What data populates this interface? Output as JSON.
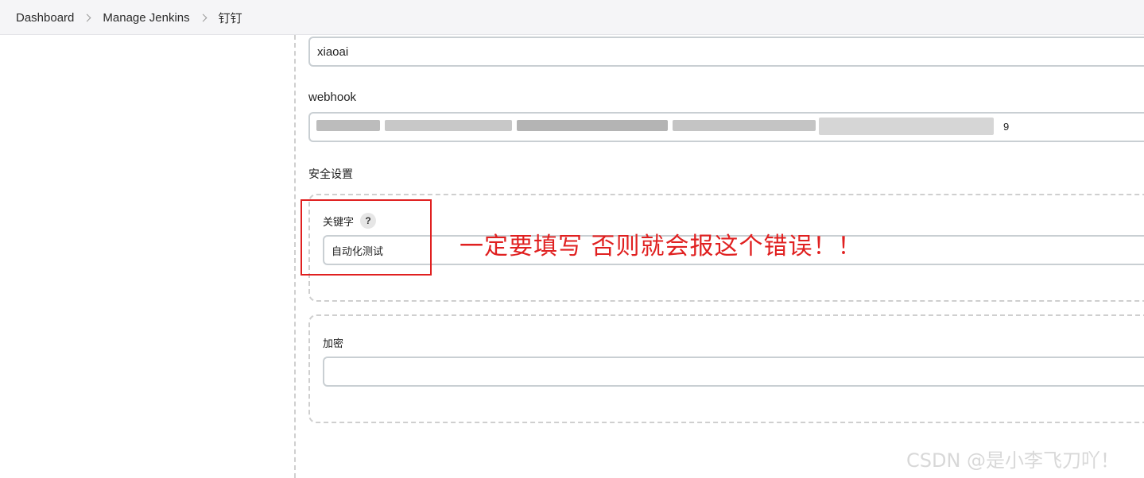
{
  "breadcrumb": [
    "Dashboard",
    "Manage Jenkins",
    "钉钉"
  ],
  "fields": {
    "name_value": "xiaoai",
    "webhook_label": "webhook",
    "webhook_value_visible_tail": "9"
  },
  "security": {
    "section_label": "安全设置",
    "keyword_label": "关键字",
    "keyword_help": "?",
    "keyword_value": "自动化测试",
    "encrypt_label": "加密",
    "encrypt_value": ""
  },
  "annotation": "一定要填写 否则就会报这个错误！！",
  "watermark": "CSDN @是小李飞刀吖！"
}
